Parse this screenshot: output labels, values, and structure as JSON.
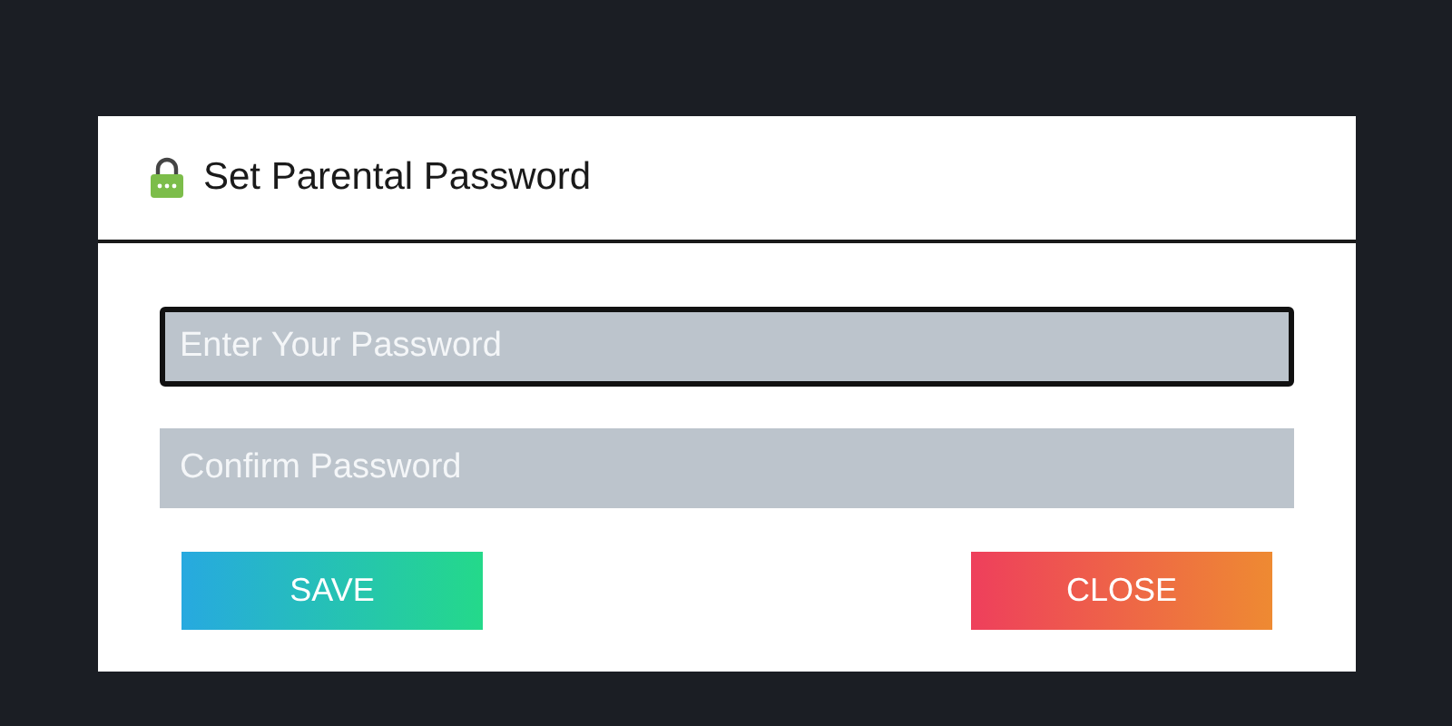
{
  "dialog": {
    "title": "Set Parental Password"
  },
  "fields": [
    {
      "placeholder": "Enter Your Password",
      "focused": true
    },
    {
      "placeholder": "Confirm Password",
      "focused": false
    }
  ],
  "buttons": [
    {
      "label": "SAVE",
      "kind": "save"
    },
    {
      "label": "CLOSE",
      "kind": "close"
    }
  ]
}
